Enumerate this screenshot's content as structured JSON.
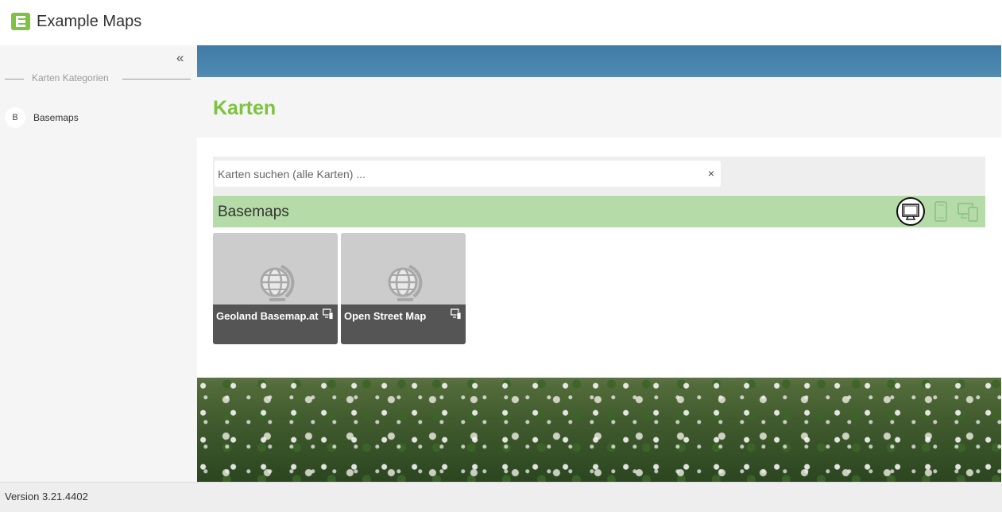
{
  "app": {
    "title": "Example Maps",
    "logo_letter": "E"
  },
  "sidebar": {
    "collapse_label": "«",
    "categories_heading": "Karten Kategorien",
    "items": [
      {
        "badge": "B",
        "label": "Basemaps"
      }
    ]
  },
  "main": {
    "title": "Karten",
    "search": {
      "placeholder": "Karten suchen (alle Karten) ...",
      "value": "",
      "clear_label": "×"
    },
    "section": {
      "title": "Basemaps",
      "view_modes": [
        "desktop-icon",
        "mobile-icon",
        "desktop-mobile-icon"
      ],
      "active_view": "desktop-icon",
      "cards": [
        {
          "title": "Geoland Basemap.at",
          "icon": "globe-icon",
          "device": "desktop-mobile-icon"
        },
        {
          "title": "Open Street Map",
          "icon": "globe-icon",
          "device": "desktop-mobile-icon"
        }
      ]
    }
  },
  "footer": {
    "version": "Version 3.21.4402"
  },
  "colors": {
    "accent": "#7dc241",
    "section_bar": "#b5dba8",
    "card_caption": "#555555"
  }
}
